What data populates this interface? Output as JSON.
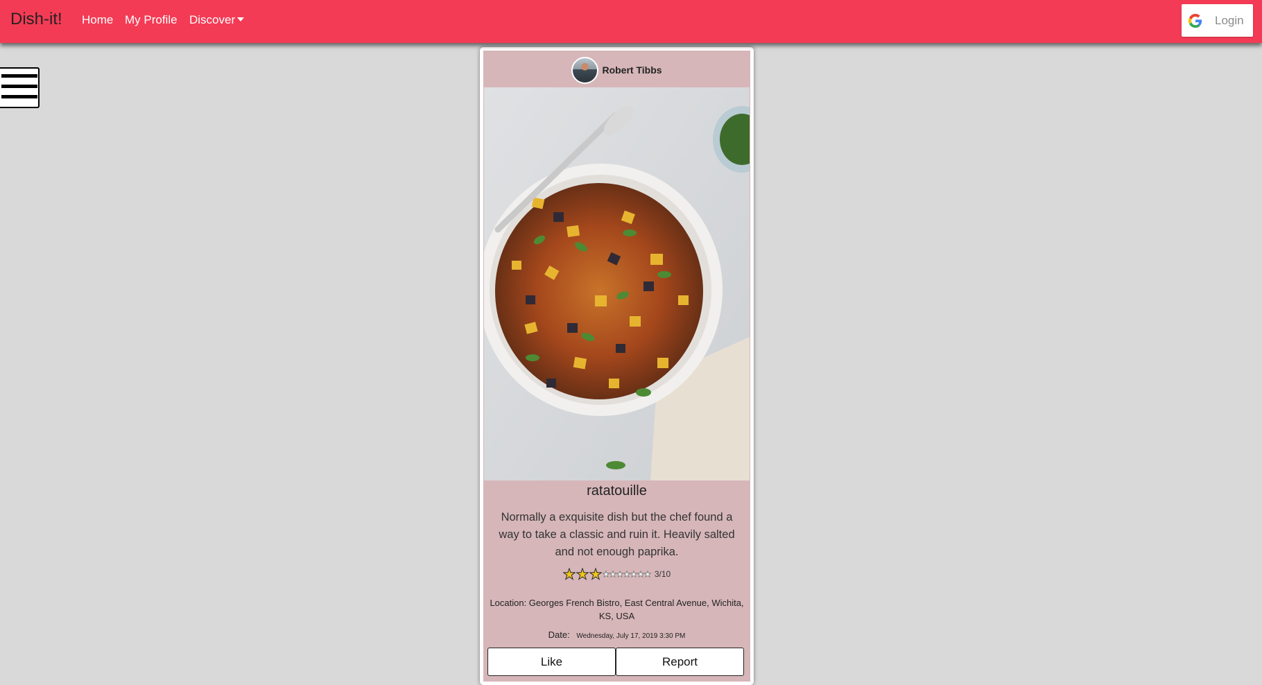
{
  "navbar": {
    "brand": "Dish-it!",
    "links": {
      "home": "Home",
      "profile": "My Profile",
      "discover": "Discover"
    },
    "login_label": "Login",
    "color": "#f43b55"
  },
  "post": {
    "author": "Robert Tibbs",
    "title": "ratatouille",
    "description": "Normally a exquisite dish but the chef found a way to take a classic and ruin it. Heavily salted and not enough paprika.",
    "rating": {
      "value": 3,
      "max": 10,
      "text": "3/10"
    },
    "location": "Location: Georges French Bistro, East Central Avenue, Wichita, KS, USA",
    "date_label": "Date:",
    "date_value": "Wednesday, July 17, 2019 3:30 PM",
    "like_label": "Like",
    "report_label": "Report",
    "card_color": "#d6b6b9"
  },
  "icons": {
    "menu": "hamburger-menu-icon",
    "login": "google-icon",
    "star_filled": "star-filled-icon",
    "star_empty": "star-empty-icon"
  }
}
